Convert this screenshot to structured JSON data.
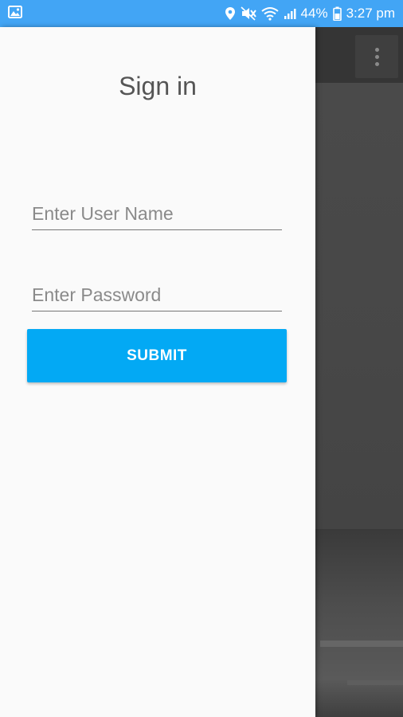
{
  "status_bar": {
    "battery_percent": "44%",
    "time": "3:27 pm",
    "icons": [
      "image-icon",
      "location-icon",
      "mute-icon",
      "wifi-icon",
      "signal-icon",
      "battery-icon"
    ],
    "background_color": "#42a5f5"
  },
  "signin": {
    "title": "Sign in",
    "username_placeholder": "Enter User Name",
    "password_placeholder": "Enter Password",
    "submit_label": "SUBMIT"
  },
  "background_app": {
    "menu_icon": "overflow-menu-icon"
  },
  "colors": {
    "accent": "#03a9f4",
    "drawer_background": "#fafafa"
  }
}
